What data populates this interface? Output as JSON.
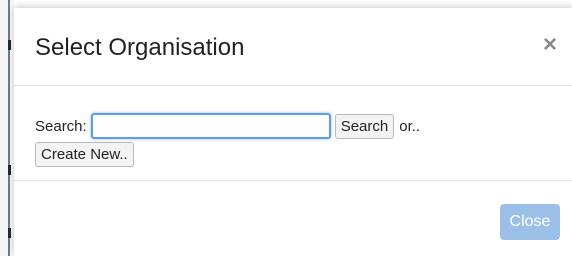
{
  "modal": {
    "title": "Select Organisation",
    "close_symbol": "×"
  },
  "search": {
    "label": "Search:",
    "input_value": "",
    "button_label": "Search",
    "or_text": "or.."
  },
  "create": {
    "button_label": "Create New.."
  },
  "footer": {
    "close_label": "Close"
  },
  "colors": {
    "input_focus_border": "#5b9bf0",
    "close_button_bg": "#9bbfe8",
    "close_x": "#8a8a8a"
  },
  "icons": {
    "dismiss": "close-icon"
  }
}
